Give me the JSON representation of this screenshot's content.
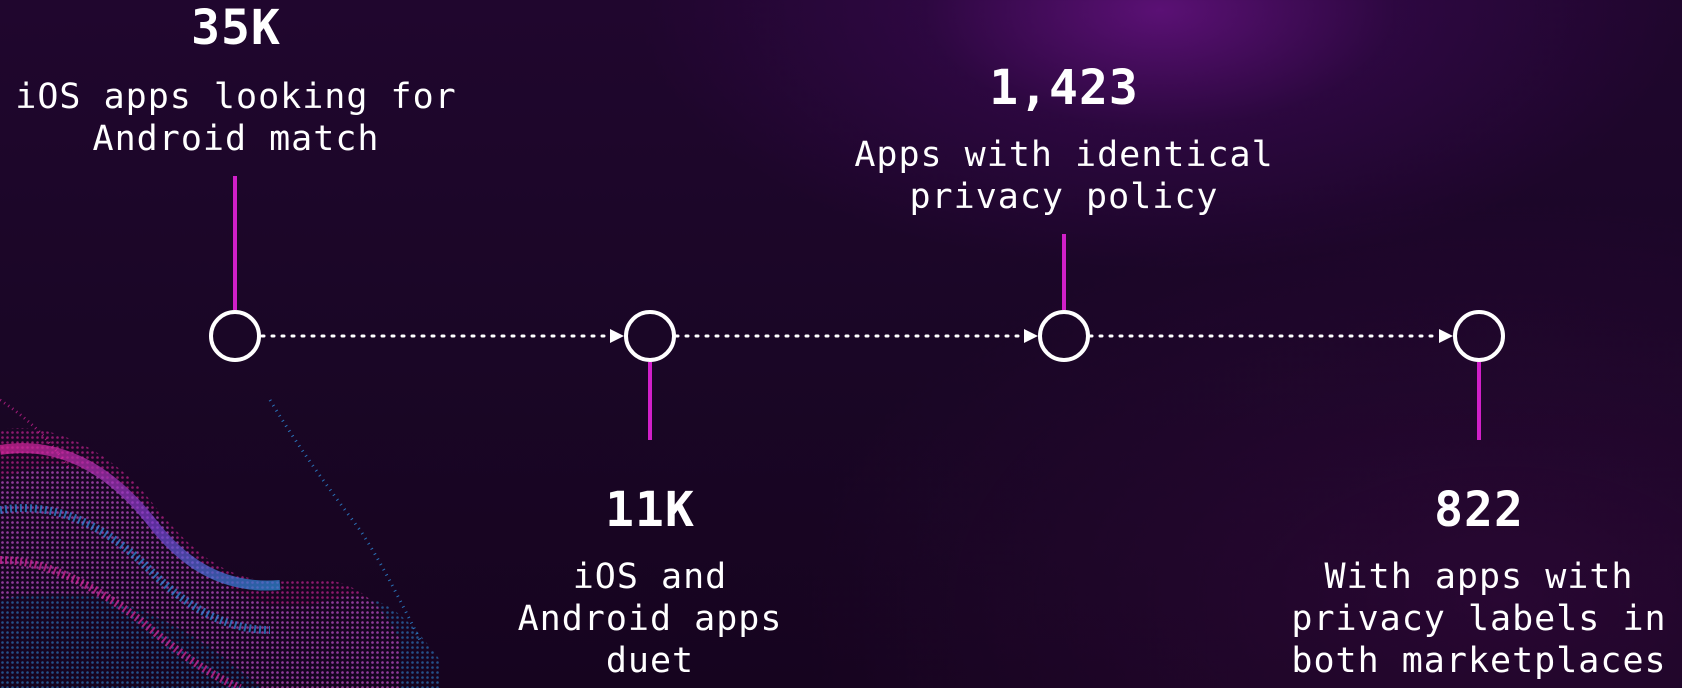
{
  "timeline": {
    "milestones": [
      {
        "value": "35K",
        "label_lines": [
          "iOS apps looking for",
          "Android match"
        ]
      },
      {
        "value": "11K",
        "label_lines": [
          "iOS and",
          "Android apps",
          "duet"
        ]
      },
      {
        "value": "1,423",
        "label_lines": [
          "Apps with identical",
          "privacy policy"
        ]
      },
      {
        "value": "822",
        "label_lines": [
          "With apps with",
          "privacy labels in",
          "both marketplaces"
        ]
      }
    ]
  },
  "colors": {
    "connector": "#d11fc9",
    "node_ring": "#ffffff",
    "dots": "#ffffff",
    "accent_pink": "#e0269f",
    "accent_blue": "#2e8fe0"
  }
}
